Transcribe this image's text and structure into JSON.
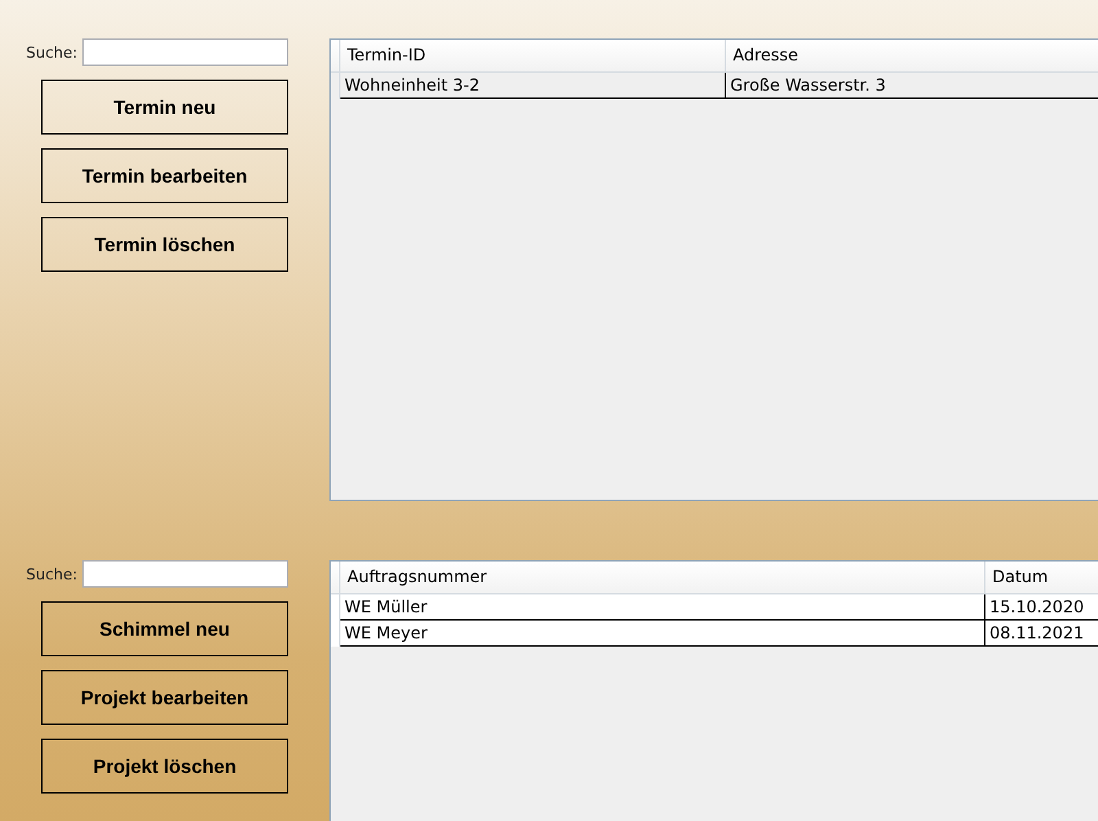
{
  "sections": [
    {
      "search": {
        "label": "Suche:"
      },
      "buttons": [
        "Termin neu",
        "Termin bearbeiten",
        "Termin löschen"
      ],
      "table": {
        "columns": [
          "Termin-ID",
          "Adresse"
        ],
        "rows": [
          [
            "Wohneinheit 3-2",
            "Große Wasserstr. 3"
          ]
        ]
      }
    },
    {
      "search": {
        "label": "Suche:"
      },
      "buttons": [
        "Schimmel neu",
        "Projekt bearbeiten",
        "Projekt löschen"
      ],
      "table": {
        "columns": [
          "Auftragsnummer",
          "Datum"
        ],
        "rows": [
          [
            "WE Müller",
            "15.10.2020"
          ],
          [
            "WE Meyer",
            "08.11.2021"
          ]
        ]
      }
    }
  ]
}
